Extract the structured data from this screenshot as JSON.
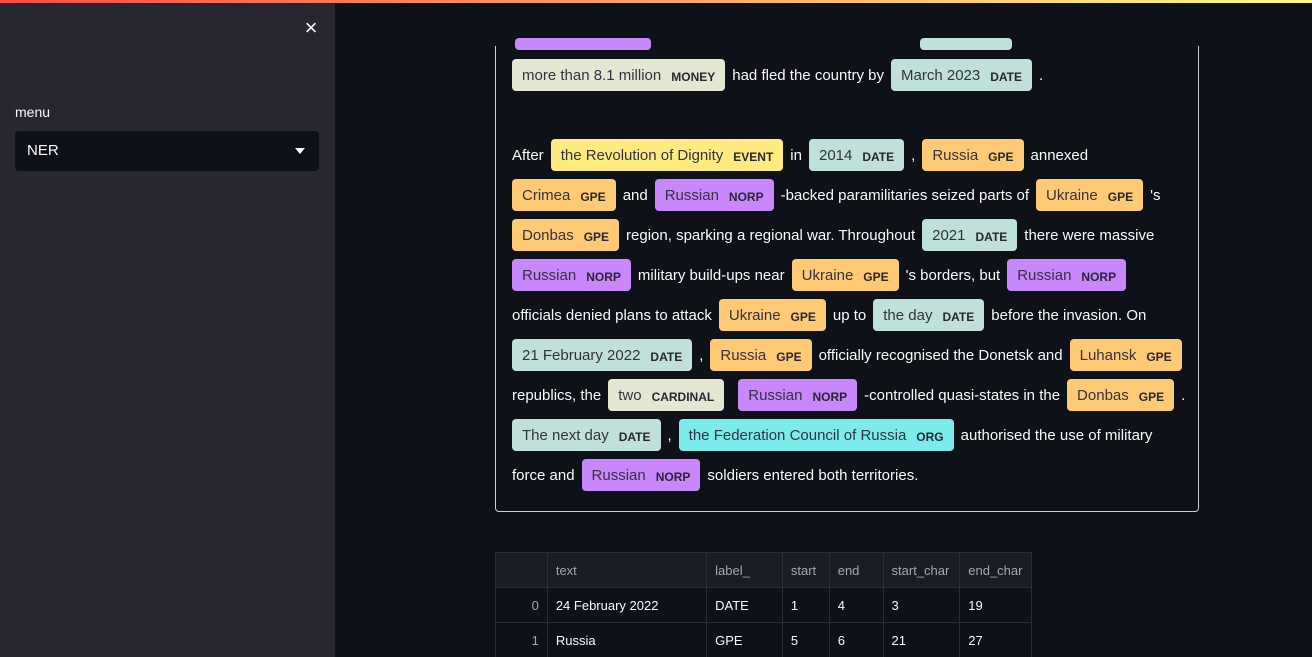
{
  "sidebar": {
    "close_label": "×",
    "menu_label": "menu",
    "select_value": "NER"
  },
  "colors": {
    "GPE": "#feca74",
    "NORP": "#c887fb",
    "DATE": "#bfe1d9",
    "EVENT": "#ffeb80",
    "MONEY": "#e4e7d2",
    "CARDINAL": "#e4e7d2",
    "ORG": "#7aecec"
  },
  "ner": {
    "lines": [
      [
        {
          "e": "more than 8.1 million",
          "l": "MONEY"
        },
        {
          "t": "had fled the country by"
        },
        {
          "e": "March 2023",
          "l": "DATE"
        },
        {
          "t": "."
        }
      ],
      [],
      [
        {
          "t": "After"
        },
        {
          "e": "the Revolution of Dignity",
          "l": "EVENT"
        },
        {
          "t": "in"
        },
        {
          "e": "2014",
          "l": "DATE"
        },
        {
          "t": ","
        },
        {
          "e": "Russia",
          "l": "GPE"
        },
        {
          "t": "annexed"
        }
      ],
      [
        {
          "e": "Crimea",
          "l": "GPE"
        },
        {
          "t": "and"
        },
        {
          "e": "Russian",
          "l": "NORP"
        },
        {
          "t": "-backed paramilitaries seized parts of"
        },
        {
          "e": "Ukraine",
          "l": "GPE"
        },
        {
          "t": "'s"
        }
      ],
      [
        {
          "e": "Donbas",
          "l": "GPE"
        },
        {
          "t": "region, sparking a regional war. Throughout"
        },
        {
          "e": "2021",
          "l": "DATE"
        },
        {
          "t": "there were massive"
        }
      ],
      [
        {
          "e": "Russian",
          "l": "NORP"
        },
        {
          "t": "military build-ups near"
        },
        {
          "e": "Ukraine",
          "l": "GPE"
        },
        {
          "t": "'s borders, but"
        },
        {
          "e": "Russian",
          "l": "NORP"
        }
      ],
      [
        {
          "t": "officials denied plans to attack"
        },
        {
          "e": "Ukraine",
          "l": "GPE"
        },
        {
          "t": "up to"
        },
        {
          "e": "the day",
          "l": "DATE"
        },
        {
          "t": "before the invasion. On"
        }
      ],
      [
        {
          "e": "21 February 2022",
          "l": "DATE"
        },
        {
          "t": ","
        },
        {
          "e": "Russia",
          "l": "GPE"
        },
        {
          "t": "officially recognised the Donetsk and"
        },
        {
          "e": "Luhansk",
          "l": "GPE"
        }
      ],
      [
        {
          "t": "republics, the"
        },
        {
          "e": "two",
          "l": "CARDINAL"
        },
        {
          "e": "Russian",
          "l": "NORP"
        },
        {
          "t": "-controlled quasi-states in the"
        },
        {
          "e": "Donbas",
          "l": "GPE"
        },
        {
          "t": "."
        }
      ],
      [
        {
          "e": "The next day",
          "l": "DATE"
        },
        {
          "t": ","
        },
        {
          "e": "the Federation Council of Russia",
          "l": "ORG"
        },
        {
          "t": "authorised the use of military"
        }
      ],
      [
        {
          "t": "force and"
        },
        {
          "e": "Russian",
          "l": "NORP"
        },
        {
          "t": "soldiers entered both territories."
        }
      ]
    ]
  },
  "table": {
    "headers": [
      "",
      "text",
      "label_",
      "start",
      "end",
      "start_char",
      "end_char"
    ],
    "rows": [
      [
        "0",
        "24 February 2022",
        "DATE",
        "1",
        "4",
        "3",
        "19"
      ],
      [
        "1",
        "Russia",
        "GPE",
        "5",
        "6",
        "21",
        "27"
      ]
    ]
  }
}
